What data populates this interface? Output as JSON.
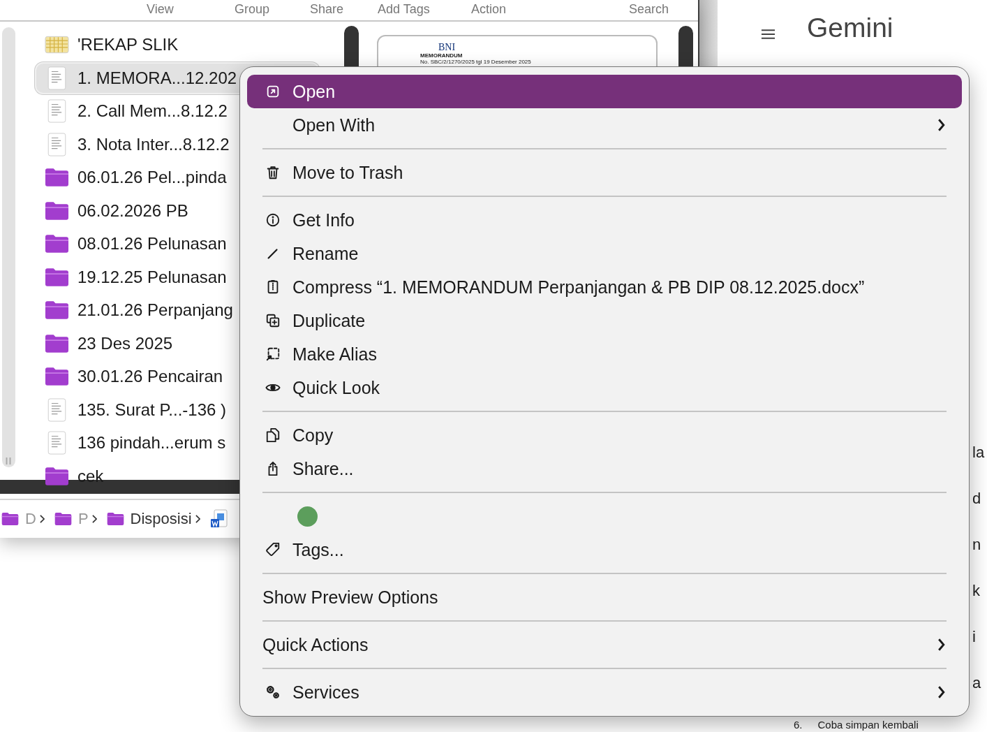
{
  "finder": {
    "toolbar": [
      "View",
      "Group",
      "Share",
      "Add Tags",
      "Action",
      "Search"
    ],
    "files": [
      {
        "name": "'REKAP SLIK",
        "kind": "spreadsheet",
        "selected": false
      },
      {
        "name": "1. MEMORA...12.202",
        "kind": "document",
        "selected": true
      },
      {
        "name": "2. Call Mem...8.12.2",
        "kind": "document",
        "selected": false
      },
      {
        "name": "3. Nota Inter...8.12.2",
        "kind": "document",
        "selected": false
      },
      {
        "name": "06.01.26 Pel...pinda",
        "kind": "folder",
        "selected": false
      },
      {
        "name": "06.02.2026 PB",
        "kind": "folder",
        "selected": false
      },
      {
        "name": "08.01.26 Pelunasan",
        "kind": "folder",
        "selected": false
      },
      {
        "name": "19.12.25 Pelunasan",
        "kind": "folder",
        "selected": false
      },
      {
        "name": "21.01.26 Perpanjang",
        "kind": "folder",
        "selected": false
      },
      {
        "name": "23 Des 2025",
        "kind": "folder",
        "selected": false
      },
      {
        "name": "30.01.26 Pencairan",
        "kind": "folder",
        "selected": false
      },
      {
        "name": "135. Surat P...-136 )",
        "kind": "document",
        "selected": false
      },
      {
        "name": "136 pindah...erum s",
        "kind": "document",
        "selected": false
      },
      {
        "name": "cek",
        "kind": "folder",
        "selected": false
      }
    ],
    "preview": {
      "logo": "BNI",
      "heading": "MEMORANDUM",
      "subheading": "No. SBC/2/1270/2025 tgl 19 Desember 2025"
    },
    "path": [
      {
        "label": "D",
        "kind": "folder"
      },
      {
        "label": "P",
        "kind": "folder"
      },
      {
        "label": "Disposisi",
        "kind": "folder"
      },
      {
        "kind": "word-document"
      }
    ]
  },
  "context_menu": {
    "items": [
      {
        "kind": "action",
        "label": "Open",
        "selected": true,
        "submenu": false
      },
      {
        "kind": "action",
        "label": "Open With",
        "selected": false,
        "submenu": true
      },
      {
        "kind": "separator"
      },
      {
        "kind": "action",
        "label": "Move to Trash",
        "selected": false,
        "submenu": false
      },
      {
        "kind": "separator"
      },
      {
        "kind": "action",
        "label": "Get Info",
        "selected": false,
        "submenu": false
      },
      {
        "kind": "action",
        "label": "Rename",
        "selected": false,
        "submenu": false
      },
      {
        "kind": "action",
        "label": "Compress “1. MEMORANDUM Perpanjangan & PB DIP 08.12.2025.docx”",
        "selected": false,
        "submenu": false
      },
      {
        "kind": "action",
        "label": "Duplicate",
        "selected": false,
        "submenu": false
      },
      {
        "kind": "action",
        "label": "Make Alias",
        "selected": false,
        "submenu": false
      },
      {
        "kind": "action",
        "label": "Quick Look",
        "selected": false,
        "submenu": false
      },
      {
        "kind": "separator"
      },
      {
        "kind": "action",
        "label": "Copy",
        "selected": false,
        "submenu": false
      },
      {
        "kind": "action",
        "label": "Share...",
        "selected": false,
        "submenu": false
      },
      {
        "kind": "separator"
      },
      {
        "kind": "color_tags",
        "tags": [
          {
            "color": "#5c9e5c"
          }
        ]
      },
      {
        "kind": "action",
        "label": "Tags...",
        "selected": false,
        "submenu": false
      },
      {
        "kind": "separator"
      },
      {
        "kind": "plain",
        "label": "Show Preview Options",
        "selected": false,
        "submenu": false
      },
      {
        "kind": "separator"
      },
      {
        "kind": "plain",
        "label": "Quick Actions",
        "selected": false,
        "submenu": true
      },
      {
        "kind": "separator"
      },
      {
        "kind": "action",
        "label": "Services",
        "selected": false,
        "submenu": true
      }
    ]
  },
  "gemini": {
    "title": "Gemini",
    "fragments": [
      "la",
      "d",
      "n",
      "k",
      "i",
      "a"
    ],
    "list_number": "6.",
    "list_text": "Coba simpan kembali"
  }
}
